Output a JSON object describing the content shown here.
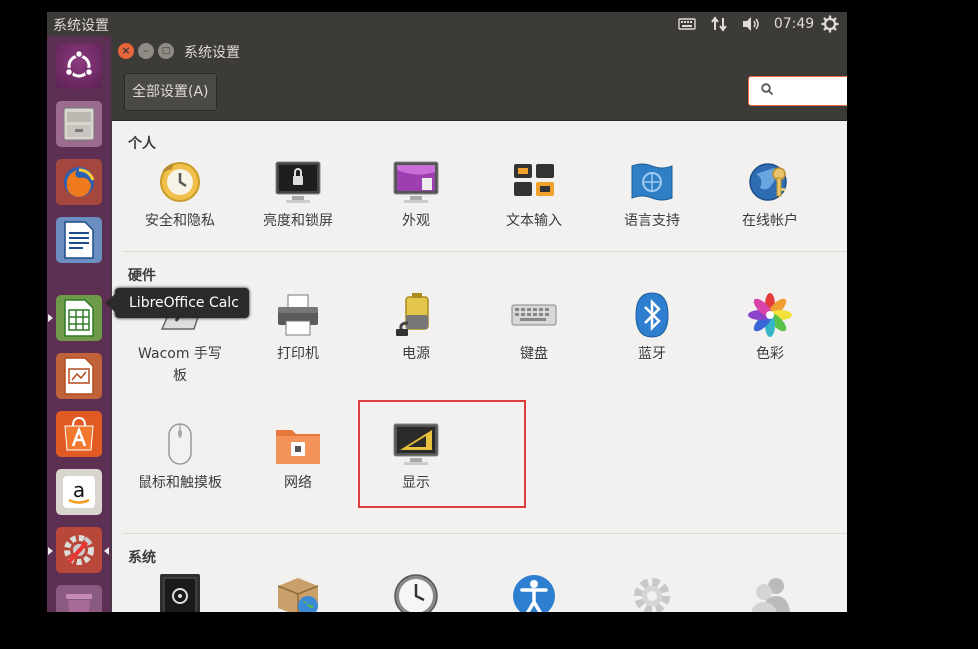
{
  "panel": {
    "title": "系统设置",
    "clock": "07:49"
  },
  "window": {
    "title": "系统设置",
    "all_settings_label": "全部设置(A)",
    "search_placeholder": ""
  },
  "tooltip": "LibreOffice Calc",
  "sections": {
    "personal": {
      "title": "个人",
      "items": [
        "安全和隐私",
        "亮度和锁屏",
        "外观",
        "文本输入",
        "语言支持",
        "在线帐户"
      ]
    },
    "hardware": {
      "title": "硬件",
      "items": [
        "Wacom 手写板",
        "打印机",
        "电源",
        "键盘",
        "蓝牙",
        "色彩",
        "鼠标和触摸板",
        "网络",
        "显示"
      ]
    },
    "system": {
      "title": "系统",
      "items": []
    }
  },
  "launcher": {
    "icons": [
      "ubuntu-dash-icon",
      "files-icon",
      "firefox-icon",
      "writer-icon",
      "calc-icon",
      "impress-icon",
      "software-center-icon",
      "amazon-icon",
      "system-settings-icon",
      "trash-icon"
    ]
  },
  "colors": {
    "launcher_bg": "#5d2f52",
    "panel_bg": "#3c3b37",
    "highlight": "#e03d3d",
    "search_border": "#e26d3b",
    "close_button": "#e6663a"
  }
}
